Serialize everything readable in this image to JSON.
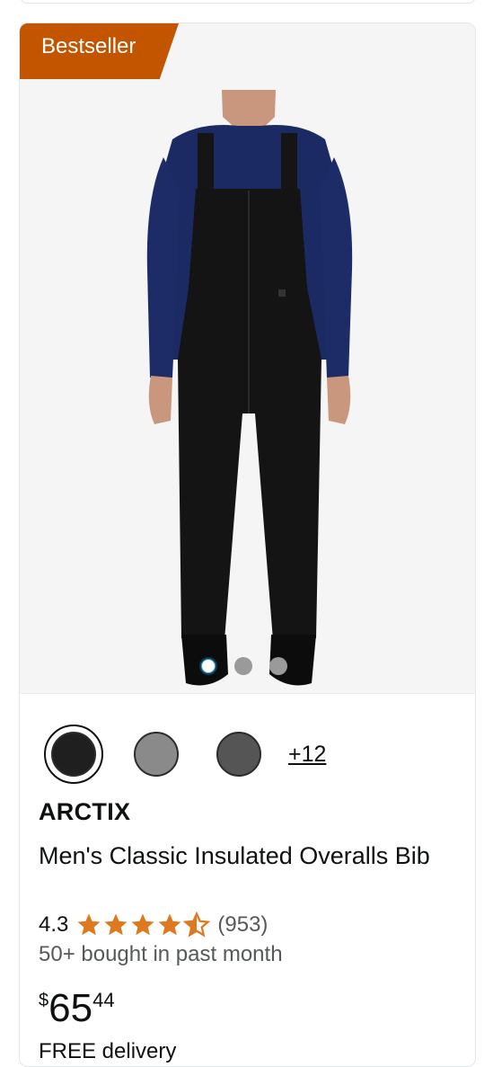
{
  "product": {
    "badge": "Bestseller",
    "brand": "ARCTIX",
    "title": "Men's Classic Insulated Overalls Bib",
    "rating": "4.3",
    "rating_value": 4.3,
    "review_count": "(953)",
    "bought": "50+ bought in past month",
    "price": {
      "symbol": "$",
      "whole": "65",
      "fraction": "44"
    },
    "delivery_partial": "FREE delivery"
  },
  "carousel": {
    "count": 3,
    "active_index": 0
  },
  "swatches": {
    "colors": [
      "#1f1f1f",
      "#8a8a8a",
      "#555555"
    ],
    "selected_index": 0,
    "more_label": "+12"
  },
  "colors": {
    "badge": "#c45500",
    "star": "#de7921"
  }
}
